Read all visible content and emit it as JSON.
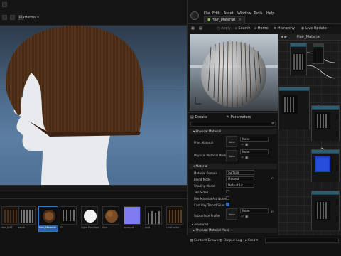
{
  "left_editor": {
    "toolbar": {
      "platforms_label": "Platforms"
    }
  },
  "content_drawer": {
    "assets": [
      {
        "label": "Hair_MAT"
      },
      {
        "label": "depth"
      },
      {
        "label": "Hair_Material"
      },
      {
        "label": "ID"
      },
      {
        "label": "Light Function"
      },
      {
        "label": "Sort"
      },
      {
        "label": "normals"
      },
      {
        "label": "root"
      },
      {
        "label": "Unlit color"
      }
    ]
  },
  "material_editor": {
    "menu": [
      "File",
      "Edit",
      "Asset",
      "Window",
      "Tools",
      "Help"
    ],
    "tab_title": "Hair_Material",
    "toolbar": {
      "apply": "Apply",
      "search": "Search",
      "home": "Home",
      "hierarchy": "Hierarchy",
      "live_update": "Live Update"
    },
    "graph_title": "Hair_Material",
    "details": {
      "tab_details": "Details",
      "tab_parameters": "Parameters",
      "section_physical_material": "Physical Material",
      "phys_material_label": "Phys Material",
      "phys_material_value": "None",
      "phys_material_mask_label": "Physical Material Mask",
      "phys_material_mask_value": "None",
      "section_material": "Material",
      "material_domain_label": "Material Domain",
      "material_domain_value": "Surface",
      "blend_mode_label": "Blend Mode",
      "blend_mode_value": "Masked",
      "shading_model_label": "Shading Model",
      "shading_model_value": "Default Lit",
      "two_sided_label": "Two Sided",
      "use_material_attributes_label": "Use Material Attributes",
      "cast_ray_traced_shadows_label": "Cast Ray Traced Shad...",
      "subsurface_profile_label": "Subsurface Profile",
      "subsurface_profile_value": "None",
      "advanced_label": "Advanced",
      "section_physical_material_mask": "Physical Material Mask"
    },
    "statusbar": {
      "content_drawer": "Content Drawer",
      "output_log": "Output Log",
      "cmd": "Cmd"
    }
  }
}
